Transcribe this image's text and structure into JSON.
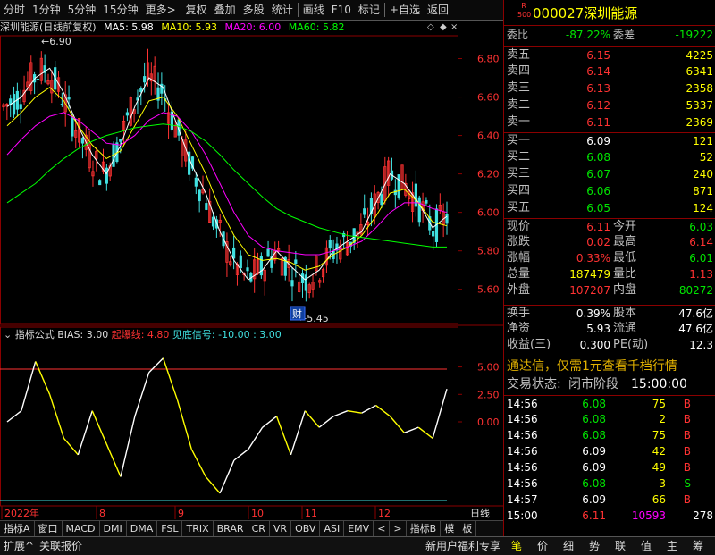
{
  "toolbar": {
    "items": [
      "分时",
      "1分钟",
      "5分钟",
      "15分钟",
      "更多>",
      "复权",
      "叠加",
      "多股",
      "统计",
      "画线",
      "F10",
      "标记",
      "+自选",
      "返回"
    ]
  },
  "chart_header": {
    "name": "深圳能源(日线前复权)",
    "ma5": "MA5: 5.98",
    "ma10": "MA10: 5.93",
    "ma20": "MA20: 6.00",
    "ma60": "MA60: 5.82",
    "high_label": "6.90",
    "low_label": "5.45",
    "finance_marker": "财"
  },
  "indicator_header": {
    "title": "指标公式",
    "bias": "BIAS: 3.00",
    "line1": "起爆线: 4.80",
    "line2": "见底信号: -10.00 : 3.00"
  },
  "price_axis": [
    "6.80",
    "6.60",
    "6.40",
    "6.20",
    "6.00",
    "5.80",
    "5.60"
  ],
  "indicator_axis": [
    "5.00",
    "2.50",
    "0.00"
  ],
  "date_axis": [
    "2022年",
    "8",
    "9",
    "10",
    "11",
    "12"
  ],
  "date_axis_right": "日线",
  "colors": {
    "up": "#ff3232",
    "down": "#40e0e0",
    "ma5": "#ffffff",
    "ma10": "#ffff00",
    "ma20": "#ff00ff",
    "ma60": "#00ff00",
    "frame": "#8b0000"
  },
  "chart_data": {
    "type": "line",
    "series": [
      {
        "name": "MA5",
        "values": [
          6.55,
          6.6,
          6.7,
          6.75,
          6.62,
          6.45,
          6.3,
          6.2,
          6.35,
          6.55,
          6.7,
          6.65,
          6.45,
          6.25,
          6.1,
          5.9,
          5.75,
          5.65,
          5.7,
          5.8,
          5.72,
          5.65,
          5.7,
          5.8,
          5.85,
          5.9,
          6.05,
          6.2,
          6.15,
          6.05,
          5.92,
          5.98
        ]
      },
      {
        "name": "MA10",
        "values": [
          6.45,
          6.52,
          6.6,
          6.65,
          6.58,
          6.45,
          6.35,
          6.28,
          6.32,
          6.45,
          6.58,
          6.6,
          6.5,
          6.35,
          6.2,
          6.02,
          5.88,
          5.78,
          5.75,
          5.76,
          5.74,
          5.7,
          5.72,
          5.78,
          5.82,
          5.88,
          5.98,
          6.1,
          6.12,
          6.05,
          5.95,
          5.93
        ]
      },
      {
        "name": "MA20",
        "values": [
          6.3,
          6.38,
          6.45,
          6.5,
          6.52,
          6.48,
          6.42,
          6.36,
          6.35,
          6.4,
          6.48,
          6.52,
          6.5,
          6.42,
          6.3,
          6.15,
          6.0,
          5.88,
          5.82,
          5.8,
          5.79,
          5.78,
          5.78,
          5.8,
          5.82,
          5.85,
          5.92,
          6.0,
          6.05,
          6.05,
          6.02,
          6.0
        ]
      },
      {
        "name": "MA60",
        "values": [
          6.05,
          6.1,
          6.15,
          6.22,
          6.28,
          6.33,
          6.37,
          6.4,
          6.42,
          6.44,
          6.45,
          6.46,
          6.45,
          6.42,
          6.37,
          6.3,
          6.22,
          6.15,
          6.08,
          6.02,
          5.98,
          5.95,
          5.92,
          5.9,
          5.88,
          5.87,
          5.86,
          5.85,
          5.84,
          5.83,
          5.82,
          5.82
        ]
      },
      {
        "name": "BIAS",
        "values": [
          0.0,
          1.0,
          5.5,
          2.5,
          -1.5,
          -3.0,
          1.0,
          -2.0,
          -5.0,
          0.5,
          4.5,
          5.8,
          2.0,
          -2.5,
          -5.0,
          -6.5,
          -3.5,
          -2.5,
          -0.5,
          0.5,
          -3.0,
          1.0,
          -0.5,
          0.5,
          1.0,
          0.8,
          1.5,
          0.5,
          -1.0,
          -0.5,
          -1.5,
          3.0
        ]
      }
    ],
    "ylim": [
      5.45,
      6.9
    ],
    "bias_ylim": [
      -7,
      7
    ],
    "bias_levels": [
      4.8,
      -10.0
    ]
  },
  "quote": {
    "code": "000027",
    "name": "深圳能源",
    "r_badge": "R",
    "r_badge_sub": "500",
    "webi_label": "委比",
    "webi": "-87.22%",
    "weicha_label": "委差",
    "weicha": "-19222",
    "sell": [
      {
        "label": "卖五",
        "price": "6.15",
        "vol": "4225"
      },
      {
        "label": "卖四",
        "price": "6.14",
        "vol": "6341"
      },
      {
        "label": "卖三",
        "price": "6.13",
        "vol": "2358"
      },
      {
        "label": "卖二",
        "price": "6.12",
        "vol": "5337"
      },
      {
        "label": "卖一",
        "price": "6.11",
        "vol": "2369"
      }
    ],
    "buy": [
      {
        "label": "买一",
        "price": "6.09",
        "vol": "121"
      },
      {
        "label": "买二",
        "price": "6.08",
        "vol": "52"
      },
      {
        "label": "买三",
        "price": "6.07",
        "vol": "240"
      },
      {
        "label": "买四",
        "price": "6.06",
        "vol": "871"
      },
      {
        "label": "买五",
        "price": "6.05",
        "vol": "124"
      }
    ],
    "stats": [
      {
        "l1": "现价",
        "v1": "6.11",
        "l2": "今开",
        "v2": "6.03"
      },
      {
        "l1": "涨跌",
        "v1": "0.02",
        "l2": "最高",
        "v2": "6.14"
      },
      {
        "l1": "涨幅",
        "v1": "0.33%",
        "l2": "最低",
        "v2": "6.01"
      },
      {
        "l1": "总量",
        "v1": "187479",
        "l2": "量比",
        "v2": "1.13"
      },
      {
        "l1": "外盘",
        "v1": "107207",
        "l2": "内盘",
        "v2": "80272"
      }
    ],
    "fin": [
      {
        "l1": "换手",
        "v1": "0.39%",
        "l2": "股本",
        "v2": "47.6亿"
      },
      {
        "l1": "净资",
        "v1": "5.93",
        "l2": "流通",
        "v2": "47.6亿"
      },
      {
        "l1": "收益(三)",
        "v1": "0.300",
        "l2": "PE(动)",
        "v2": "12.3"
      }
    ],
    "promo": "通达信，仅需1元查看千档行情",
    "trade_status_label": "交易状态:",
    "trade_status": "闭市阶段",
    "trade_time": "15:00:00",
    "ticks": [
      {
        "t": "14:56",
        "p": "6.08",
        "v": "75",
        "s": "B"
      },
      {
        "t": "14:56",
        "p": "6.08",
        "v": "2",
        "s": "B"
      },
      {
        "t": "14:56",
        "p": "6.08",
        "v": "75",
        "s": "B"
      },
      {
        "t": "14:56",
        "p": "6.09",
        "v": "42",
        "s": "B"
      },
      {
        "t": "14:56",
        "p": "6.09",
        "v": "49",
        "s": "B"
      },
      {
        "t": "14:56",
        "p": "6.08",
        "v": "3",
        "s": "S"
      },
      {
        "t": "14:57",
        "p": "6.09",
        "v": "66",
        "s": "B"
      },
      {
        "t": "15:00",
        "p": "6.11",
        "v": "10593",
        "s": "278"
      }
    ]
  },
  "tabs": [
    "指标A",
    "窗口",
    "MACD",
    "DMI",
    "DMA",
    "FSL",
    "TRIX",
    "BRAR",
    "CR",
    "VR",
    "OBV",
    "ASI",
    "EMV",
    "<",
    ">",
    "指标B",
    "模",
    "板"
  ],
  "status": {
    "left1": "扩展^",
    "left2": "关联报价",
    "right1": "新用户福利专享",
    "btns": [
      "笔",
      "价",
      "细",
      "势",
      "联",
      "值",
      "主",
      "筹"
    ]
  }
}
